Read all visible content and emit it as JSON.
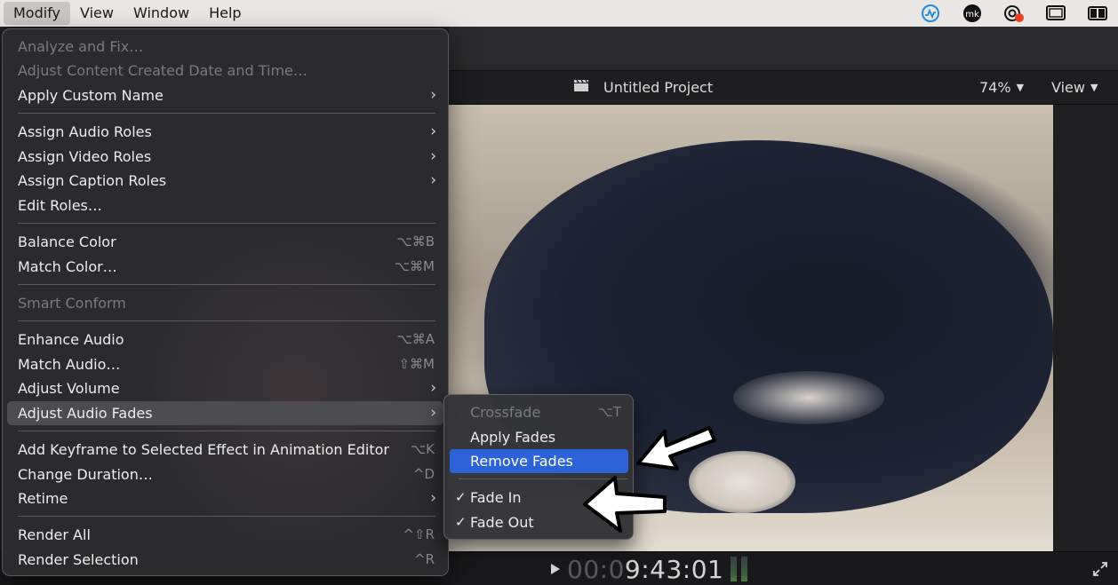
{
  "menubar": {
    "items": [
      "Modify",
      "View",
      "Window",
      "Help"
    ],
    "active": "Modify",
    "status_icons": [
      "activity-icon",
      "mk-avatar-icon",
      "cloud-sync-icon",
      "window-layout-icon",
      "sidebar-toggle-icon"
    ],
    "avatar_text": "mk"
  },
  "viewer": {
    "project_title": "Untitled Project",
    "zoom": "74%",
    "view_label": "View"
  },
  "timeline": {
    "timecode_dim": "00:0",
    "timecode_bright": "9:43:01"
  },
  "modify_menu": {
    "items": [
      {
        "label": "Analyze and Fix…",
        "shortcut": "",
        "submenu": false,
        "enabled": false
      },
      {
        "label": "Adjust Content Created Date and Time…",
        "shortcut": "",
        "submenu": false,
        "enabled": false
      },
      {
        "label": "Apply Custom Name",
        "shortcut": "",
        "submenu": true,
        "enabled": true
      },
      {
        "label": "Assign Audio Roles",
        "shortcut": "",
        "submenu": true,
        "enabled": true
      },
      {
        "label": "Assign Video Roles",
        "shortcut": "",
        "submenu": true,
        "enabled": true
      },
      {
        "label": "Assign Caption Roles",
        "shortcut": "",
        "submenu": true,
        "enabled": true
      },
      {
        "label": "Edit Roles…",
        "shortcut": "",
        "submenu": false,
        "enabled": true
      },
      {
        "label": "Balance Color",
        "shortcut": "⌥⌘B",
        "submenu": false,
        "enabled": true
      },
      {
        "label": "Match Color…",
        "shortcut": "⌥⌘M",
        "submenu": false,
        "enabled": true
      },
      {
        "label": "Smart Conform",
        "shortcut": "",
        "submenu": false,
        "enabled": false
      },
      {
        "label": "Enhance Audio",
        "shortcut": "⌥⌘A",
        "submenu": false,
        "enabled": true
      },
      {
        "label": "Match Audio…",
        "shortcut": "⇧⌘M",
        "submenu": false,
        "enabled": true
      },
      {
        "label": "Adjust Volume",
        "shortcut": "",
        "submenu": true,
        "enabled": true
      },
      {
        "label": "Adjust Audio Fades",
        "shortcut": "",
        "submenu": true,
        "enabled": true,
        "highlighted": true
      },
      {
        "label": "Add Keyframe to Selected Effect in Animation Editor",
        "shortcut": "⌥K",
        "submenu": false,
        "enabled": true
      },
      {
        "label": "Change Duration…",
        "shortcut": "^D",
        "submenu": false,
        "enabled": true
      },
      {
        "label": "Retime",
        "shortcut": "",
        "submenu": true,
        "enabled": true
      },
      {
        "label": "Render All",
        "shortcut": "^⇧R",
        "submenu": false,
        "enabled": true
      },
      {
        "label": "Render Selection",
        "shortcut": "^R",
        "submenu": false,
        "enabled": true
      }
    ],
    "submenu_arrow": "›"
  },
  "fades_submenu": {
    "items": [
      {
        "label": "Crossfade",
        "shortcut": "⌥T",
        "enabled": false,
        "checked": false
      },
      {
        "label": "Apply Fades",
        "shortcut": "",
        "enabled": true,
        "checked": false
      },
      {
        "label": "Remove Fades",
        "shortcut": "",
        "enabled": true,
        "checked": false,
        "selected": true
      },
      {
        "label": "Fade In",
        "shortcut": "",
        "enabled": true,
        "checked": true
      },
      {
        "label": "Fade Out",
        "shortcut": "",
        "enabled": true,
        "checked": true
      }
    ],
    "check_mark": "✓"
  },
  "colors": {
    "menu_bg": "#2c2c30",
    "selection_blue": "#2d63d8",
    "highlight_gray": "#4c4c51",
    "menubar_bg": "#e9e6e3"
  }
}
